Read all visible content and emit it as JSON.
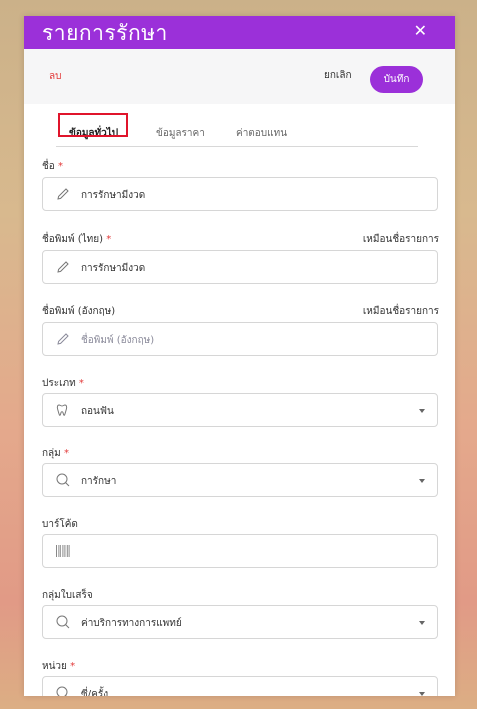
{
  "header": {
    "title": "รายการรักษา",
    "close_label": "✕"
  },
  "toolbar": {
    "delete_label": "ลบ",
    "cancel_label": "ยกเลิก",
    "save_label": "บันทึก"
  },
  "tabs": [
    {
      "label": "ข้อมูลทั่วไป",
      "active": true
    },
    {
      "label": "ข้อมูลราคา",
      "active": false
    },
    {
      "label": "ค่าตอบแทน",
      "active": false
    }
  ],
  "form": {
    "name": {
      "label": "ชื่อ",
      "required": "*",
      "value": "การรักษามีงวด"
    },
    "print_name_th": {
      "label": "ชื่อพิมพ์ (ไทย)",
      "required": "*",
      "side_link": "เหมือนชื่อรายการ",
      "value": "การรักษามีงวด"
    },
    "print_name_en": {
      "label": "ชื่อพิมพ์ (อังกฤษ)",
      "side_link": "เหมือนชื่อรายการ",
      "placeholder": "ชื่อพิมพ์ (อังกฤษ)"
    },
    "type": {
      "label": "ประเภท",
      "required": "*",
      "value": "ถอนฟัน"
    },
    "group": {
      "label": "กลุ่ม",
      "required": "*",
      "value": "การักษา"
    },
    "barcode": {
      "label": "บาร์โค้ด"
    },
    "receipt_group": {
      "label": "กลุ่มใบเสร็จ",
      "value": "ค่าบริการทางการแพทย์"
    },
    "unit": {
      "label": "หน่วย",
      "required": "*",
      "value": "ซี่/ครั้ง"
    }
  }
}
